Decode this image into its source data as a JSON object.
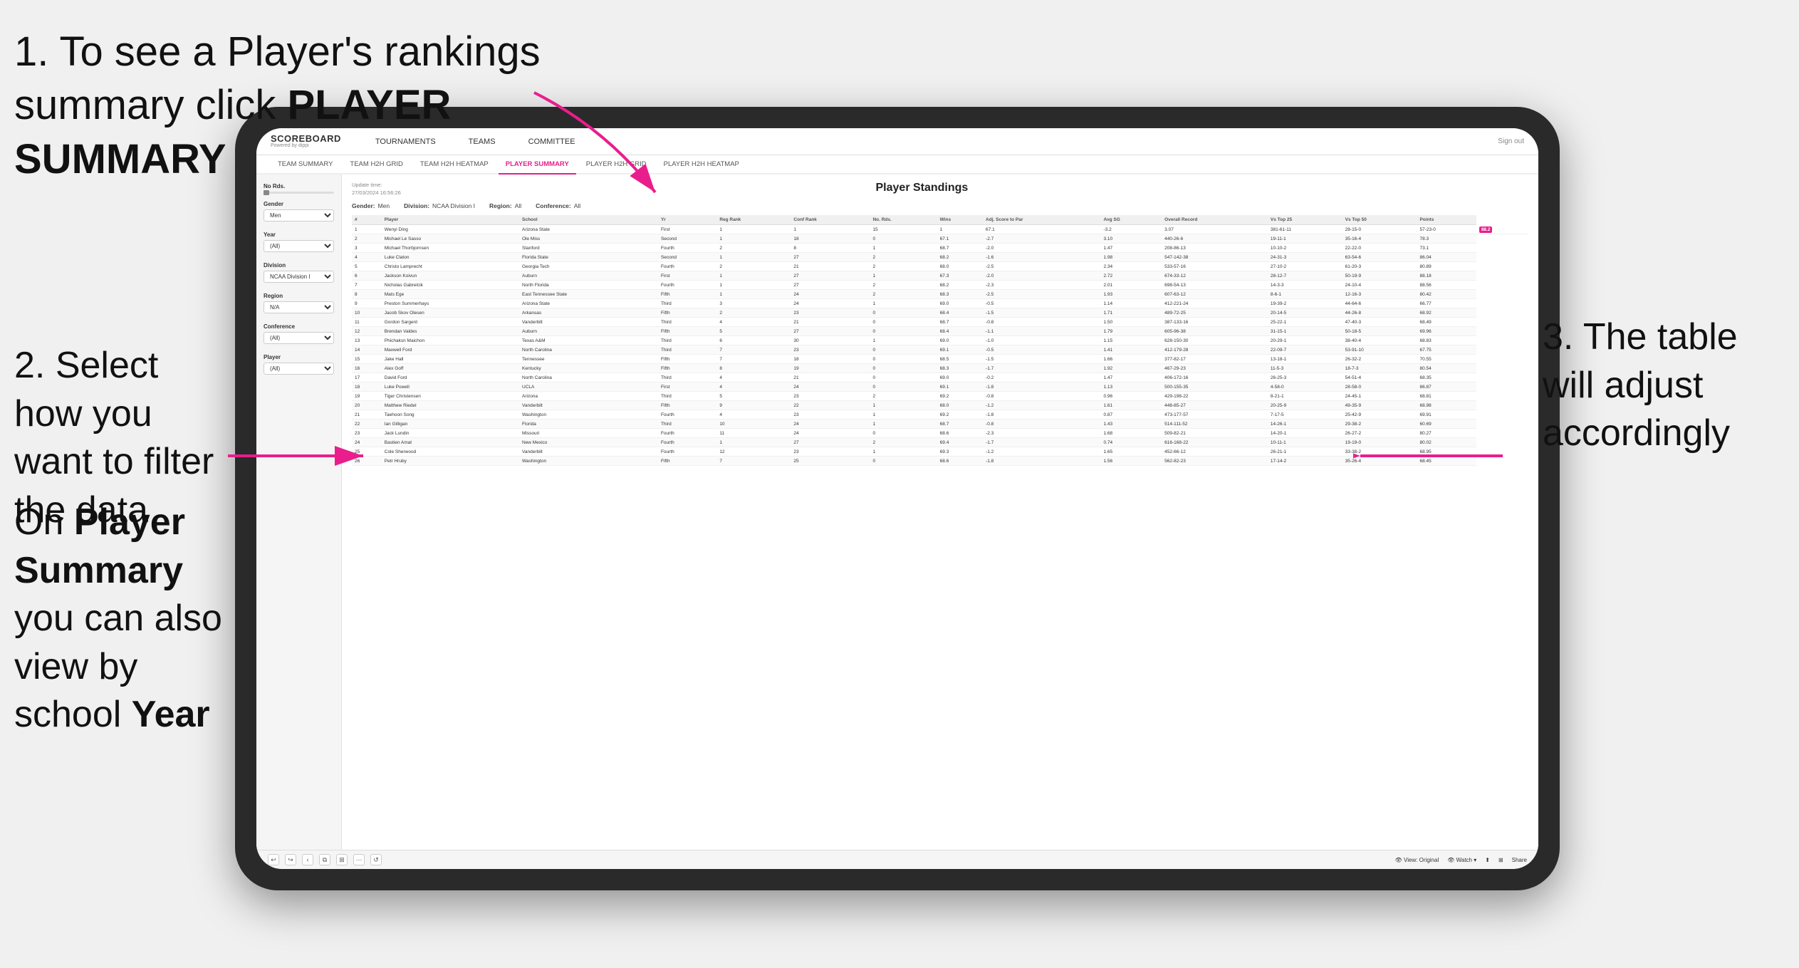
{
  "annotations": {
    "step1": "1. To see a Player's rankings summary click ",
    "step1_bold": "PLAYER SUMMARY",
    "step2_title": "2. Select how you want to filter the data",
    "step3_title": "3. The table will adjust accordingly",
    "step4_title": "On ",
    "step4_bold1": "Player Summary",
    "step4_mid": " you can also view by school ",
    "step4_bold2": "Year"
  },
  "navbar": {
    "logo": "SCOREBOARD",
    "logo_sub": "Powered by dippi",
    "nav_items": [
      "TOURNAMENTS",
      "TEAMS",
      "COMMITTEE"
    ],
    "nav_right": "Sign out"
  },
  "subnav": {
    "items": [
      "TEAM SUMMARY",
      "TEAM H2H GRID",
      "TEAM H2H HEATMAP",
      "PLAYER SUMMARY",
      "PLAYER H2H GRID",
      "PLAYER H2H HEATMAP"
    ],
    "active": "PLAYER SUMMARY"
  },
  "sidebar": {
    "no_rds_label": "No Rds.",
    "gender_label": "Gender",
    "gender_value": "Men",
    "year_label": "Year",
    "year_value": "(All)",
    "division_label": "Division",
    "division_value": "NCAA Division I",
    "region_label": "Region",
    "region_value": "N/A",
    "conference_label": "Conference",
    "conference_value": "(All)",
    "player_label": "Player",
    "player_value": "(All)"
  },
  "table": {
    "title": "Player Standings",
    "update_time": "Update time:\n27/03/2024 16:56:26",
    "filters": {
      "gender": "Men",
      "division": "NCAA Division I",
      "region": "All",
      "conference": "All"
    },
    "columns": [
      "#",
      "Player",
      "School",
      "Yr",
      "Reg Rank",
      "Conf Rank",
      "No. Rds.",
      "Wins",
      "Adj. Score to Par",
      "Avg SG",
      "Overall Record",
      "Vs Top 25",
      "Vs Top 50",
      "Points"
    ],
    "rows": [
      [
        "1",
        "Wenyi Ding",
        "Arizona State",
        "First",
        "1",
        "1",
        "15",
        "1",
        "67.1",
        "-3.2",
        "3.07",
        "381-61-11",
        "28-15-0",
        "57-23-0",
        "88.2"
      ],
      [
        "2",
        "Michael Le Sasso",
        "Ole Miss",
        "Second",
        "1",
        "18",
        "0",
        "67.1",
        "-2.7",
        "3.10",
        "440-26-6",
        "19-11-1",
        "35-16-4",
        "78.3"
      ],
      [
        "3",
        "Michael Thorbjornsen",
        "Stanford",
        "Fourth",
        "2",
        "8",
        "1",
        "68.7",
        "-2.0",
        "1.47",
        "208-86-13",
        "10-10-2",
        "22-22-0",
        "73.1"
      ],
      [
        "4",
        "Luke Claton",
        "Florida State",
        "Second",
        "1",
        "27",
        "2",
        "68.2",
        "-1.6",
        "1.98",
        "547-142-38",
        "24-31-3",
        "63-54-6",
        "86.04"
      ],
      [
        "5",
        "Christo Lamprecht",
        "Georgia Tech",
        "Fourth",
        "2",
        "21",
        "2",
        "68.0",
        "-2.5",
        "2.34",
        "533-57-16",
        "27-10-2",
        "61-20-3",
        "80.89"
      ],
      [
        "6",
        "Jackson Koivun",
        "Auburn",
        "First",
        "1",
        "27",
        "1",
        "67.3",
        "-2.0",
        "2.72",
        "674-33-12",
        "28-12-7",
        "50-19-9",
        "88.18"
      ],
      [
        "7",
        "Nicholas Gabrelcik",
        "North Florida",
        "Fourth",
        "1",
        "27",
        "2",
        "68.2",
        "-2.3",
        "2.01",
        "698-54-13",
        "14-3-3",
        "24-10-4",
        "88.56"
      ],
      [
        "8",
        "Mats Ege",
        "East Tennessee State",
        "Fifth",
        "1",
        "24",
        "2",
        "68.3",
        "-2.5",
        "1.93",
        "607-63-12",
        "8-6-1",
        "12-16-3",
        "80.42"
      ],
      [
        "9",
        "Preston Summerhays",
        "Arizona State",
        "Third",
        "3",
        "24",
        "1",
        "69.0",
        "-0.5",
        "1.14",
        "412-221-24",
        "19-39-2",
        "44-64-6",
        "66.77"
      ],
      [
        "10",
        "Jacob Skov Olesen",
        "Arkansas",
        "Fifth",
        "2",
        "23",
        "0",
        "68.4",
        "-1.5",
        "1.71",
        "489-72-25",
        "20-14-5",
        "44-26-8",
        "68.92"
      ],
      [
        "11",
        "Gordon Sargent",
        "Vanderbilt",
        "Third",
        "4",
        "21",
        "0",
        "68.7",
        "-0.8",
        "1.50",
        "387-133-16",
        "25-22-1",
        "47-40-3",
        "68.49"
      ],
      [
        "12",
        "Brendan Valdes",
        "Auburn",
        "Fifth",
        "5",
        "27",
        "0",
        "68.4",
        "-1.1",
        "1.79",
        "605-96-38",
        "31-15-1",
        "50-18-5",
        "69.96"
      ],
      [
        "13",
        "Phichaksn Maichon",
        "Texas A&M",
        "Third",
        "6",
        "30",
        "1",
        "69.0",
        "-1.0",
        "1.15",
        "628-150-30",
        "20-29-1",
        "38-40-4",
        "68.83"
      ],
      [
        "14",
        "Maxwell Ford",
        "North Carolina",
        "Third",
        "7",
        "23",
        "0",
        "69.1",
        "-0.5",
        "1.41",
        "412-179-28",
        "22-09-7",
        "53-91-10",
        "67.75"
      ],
      [
        "15",
        "Jake Hall",
        "Tennessee",
        "Fifth",
        "7",
        "18",
        "0",
        "68.5",
        "-1.5",
        "1.66",
        "377-82-17",
        "13-18-1",
        "26-32-2",
        "70.55"
      ],
      [
        "16",
        "Alex Goff",
        "Kentucky",
        "Fifth",
        "8",
        "19",
        "0",
        "68.3",
        "-1.7",
        "1.92",
        "467-29-23",
        "11-5-3",
        "18-7-3",
        "80.54"
      ],
      [
        "17",
        "David Ford",
        "North Carolina",
        "Third",
        "4",
        "21",
        "0",
        "69.0",
        "-0.2",
        "1.47",
        "406-172-16",
        "26-25-3",
        "54-51-4",
        "68.35"
      ],
      [
        "18",
        "Luke Powell",
        "UCLA",
        "First",
        "4",
        "24",
        "0",
        "69.1",
        "-1.8",
        "1.13",
        "500-155-35",
        "4-58-0",
        "28-58-0",
        "86.87"
      ],
      [
        "19",
        "Tiger Christensen",
        "Arizona",
        "Third",
        "5",
        "23",
        "2",
        "69.2",
        "-0.8",
        "0.96",
        "429-198-22",
        "8-21-1",
        "24-45-1",
        "68.81"
      ],
      [
        "20",
        "Matthew Riedel",
        "Vanderbilt",
        "Fifth",
        "9",
        "22",
        "1",
        "68.0",
        "-1.2",
        "1.61",
        "448-85-27",
        "20-25-9",
        "49-35-9",
        "68.98"
      ],
      [
        "21",
        "Taehoon Song",
        "Washington",
        "Fourth",
        "4",
        "23",
        "1",
        "69.2",
        "-1.8",
        "0.87",
        "473-177-57",
        "7-17-5",
        "25-42-9",
        "69.91"
      ],
      [
        "22",
        "Ian Gilligan",
        "Florida",
        "Third",
        "10",
        "24",
        "1",
        "68.7",
        "-0.8",
        "1.43",
        "514-111-52",
        "14-26-1",
        "29-38-2",
        "60.69"
      ],
      [
        "23",
        "Jack Lundin",
        "Missouri",
        "Fourth",
        "11",
        "24",
        "0",
        "68.6",
        "-2.3",
        "1.68",
        "509-82-21",
        "14-20-1",
        "26-27-2",
        "80.27"
      ],
      [
        "24",
        "Bastien Amat",
        "New Mexico",
        "Fourth",
        "1",
        "27",
        "2",
        "69.4",
        "-1.7",
        "0.74",
        "616-168-22",
        "10-11-1",
        "19-19-0",
        "80.02"
      ],
      [
        "25",
        "Cole Sherwood",
        "Vanderbilt",
        "Fourth",
        "12",
        "23",
        "1",
        "69.3",
        "-1.2",
        "1.65",
        "452-66-12",
        "26-21-1",
        "33-38-2",
        "68.95"
      ],
      [
        "26",
        "Petr Hruby",
        "Washington",
        "Fifth",
        "7",
        "25",
        "0",
        "68.6",
        "-1.8",
        "1.56",
        "562-82-23",
        "17-14-2",
        "35-26-4",
        "68.45"
      ]
    ]
  },
  "toolbar": {
    "view_label": "View: Original",
    "watch_label": "Watch",
    "share_label": "Share"
  }
}
